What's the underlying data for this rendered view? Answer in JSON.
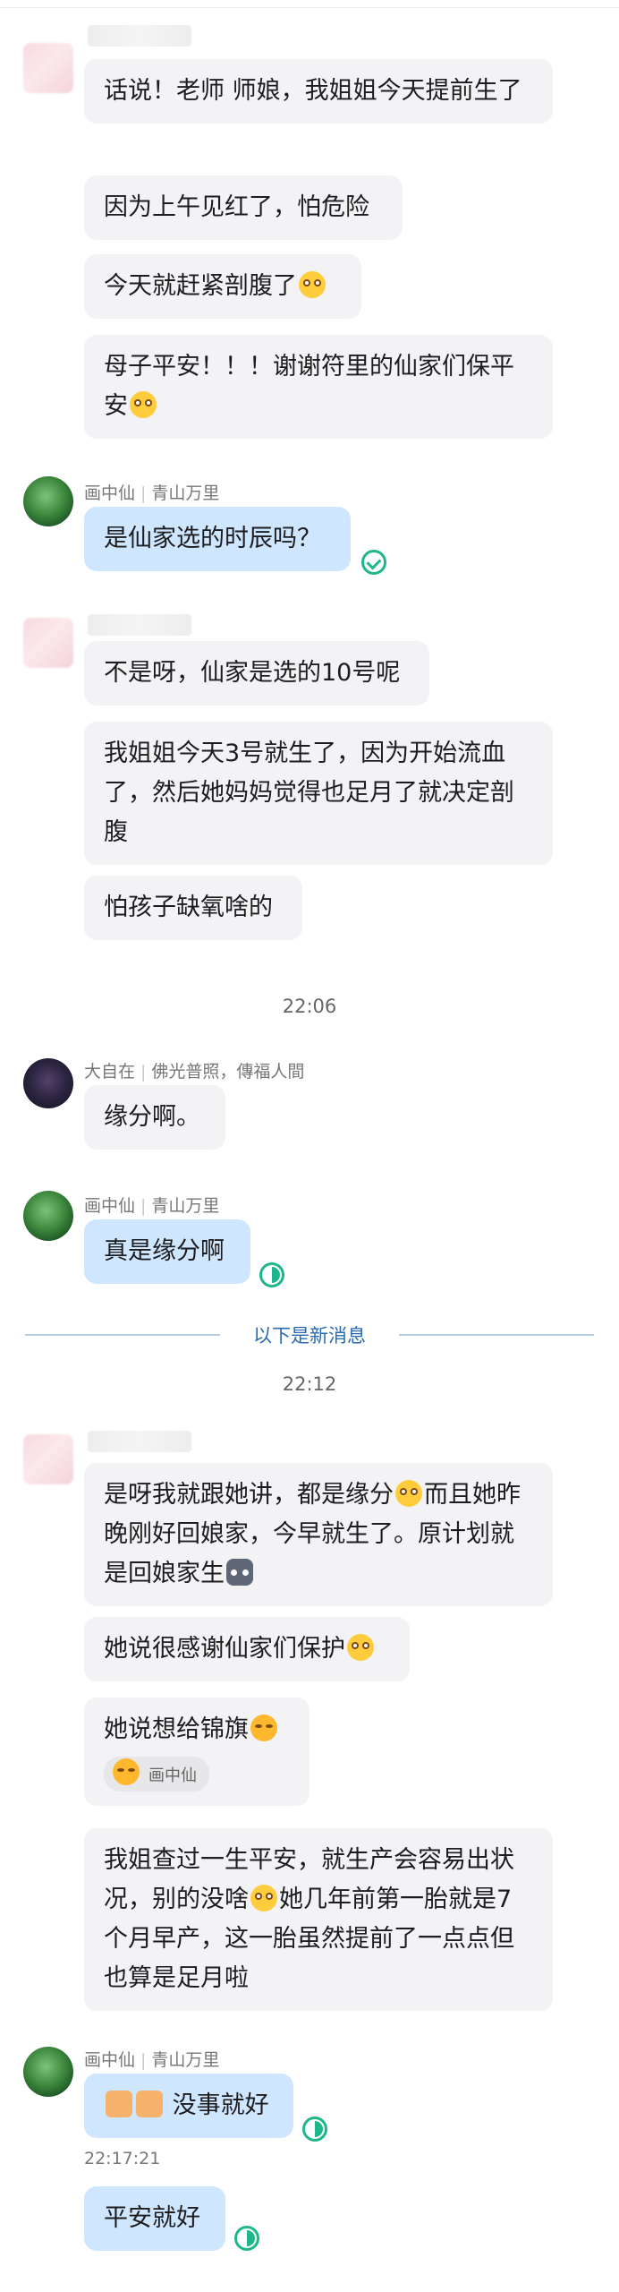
{
  "groups": {
    "g1_messages": [
      "话说！老师 师娘，我姐姐今天提前生了",
      "因为上午见红了，怕危险",
      "今天就赶紧剖腹了",
      "母子平安！！！谢谢符里的仙家们保平安"
    ],
    "g2_sender": {
      "name": "画中仙",
      "tag": "青山万里"
    },
    "g2_message": "是仙家选的时辰吗？",
    "g3_messages": [
      "不是呀，仙家是选的10号呢",
      "我姐姐今天3号就生了，因为开始流血了，然后她妈妈觉得也足月了就决定剖腹",
      "怕孩子缺氧啥的"
    ],
    "time1": "22:06",
    "g4_sender": {
      "name": "大自在",
      "tag": "佛光普照，傳福人間"
    },
    "g4_message": "缘分啊。",
    "g5_sender": {
      "name": "画中仙",
      "tag": "青山万里"
    },
    "g5_message": "真是缘分啊",
    "new_divider": "以下是新消息",
    "time2": "22:12",
    "g6_messages": {
      "m1a": "是呀我就跟她讲，都是缘分",
      "m1b": "而且她昨晚刚好回娘家，今早就生了。原计划就是回娘家生",
      "m2": "她说很感谢仙家们保护",
      "m3": "她说想给锦旗",
      "m3_reaction_user": "画中仙",
      "m4a": "我姐查过一生平安，就生产会容易出状况，别的没啥",
      "m4b": "她几年前第一胎就是7个月早产，这一胎虽然提前了一点点但也算是足月啦"
    },
    "g7_sender": {
      "name": "画中仙",
      "tag": "青山万里"
    },
    "g7_message": "没事就好",
    "g7_timestamp": "22:17:21",
    "g7_message2": "平安就好"
  },
  "icons": {
    "read": "check-circle-icon",
    "partial_read": "half-circle-icon",
    "emoji": "grin-emoji-icon"
  },
  "colors": {
    "my_bubble": "#cfe6ff",
    "other_bubble": "#f3f3f5",
    "status": "#1fb68c",
    "divider_text": "#2a6bb0"
  }
}
